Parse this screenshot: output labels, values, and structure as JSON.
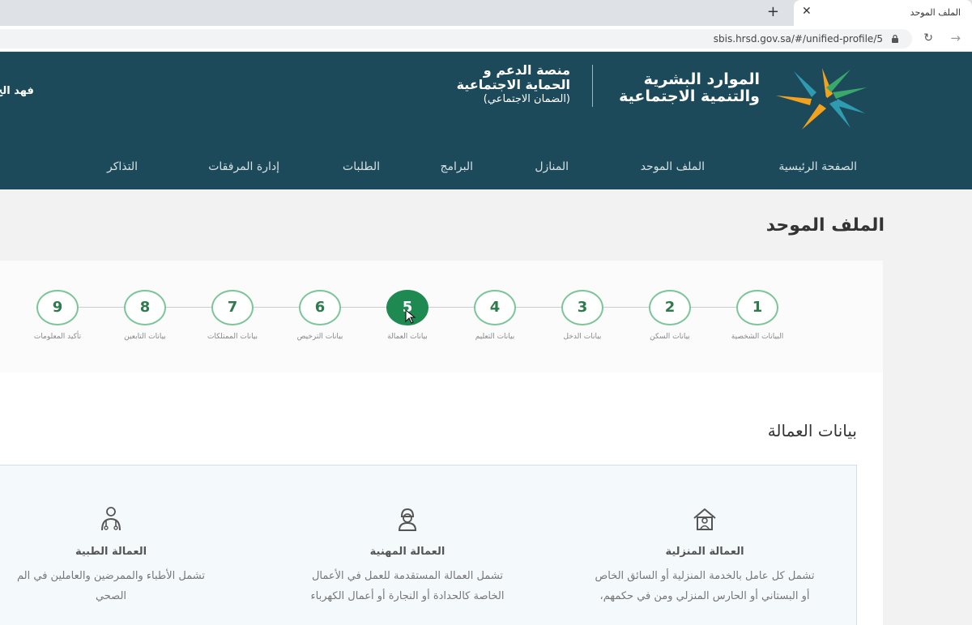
{
  "browser": {
    "tab_title": "الملف الموحد",
    "tab_close": "✕",
    "new_tab": "+",
    "url": "sbis.hrsd.gov.sa/#/unified-profile/5"
  },
  "header": {
    "ministry_line1": "الموارد البشرية",
    "ministry_line2": "والتنمية الاجتماعية",
    "platform_line1": "منصة الدعم و",
    "platform_line2": "الحماية الاجتماعية",
    "platform_line3": "(الضمان الاجتماعي)",
    "user_name": "فهد الح",
    "nav": [
      {
        "label": "الصفحة الرئيسية"
      },
      {
        "label": "الملف الموحد"
      },
      {
        "label": "المنازل"
      },
      {
        "label": "البرامج"
      },
      {
        "label": "الطلبات"
      },
      {
        "label": "إدارة المرفقات"
      },
      {
        "label": "التذاكر"
      }
    ],
    "colors": {
      "header_bg": "#1d4a5a",
      "accent_green": "#1e8a52"
    }
  },
  "page": {
    "title": "الملف الموحد",
    "section_title": "بيانات العمالة"
  },
  "stepper": {
    "active_step": 5,
    "steps": [
      {
        "num": "1",
        "label": "البيانات الشخصية"
      },
      {
        "num": "2",
        "label": "بيانات السكن"
      },
      {
        "num": "3",
        "label": "بيانات الدخل"
      },
      {
        "num": "4",
        "label": "بيانات التعليم"
      },
      {
        "num": "5",
        "label": "بيانات العمالة"
      },
      {
        "num": "6",
        "label": "بيانات الترخيص"
      },
      {
        "num": "7",
        "label": "بيانات الممتلكات"
      },
      {
        "num": "8",
        "label": "بيانات التابعين"
      },
      {
        "num": "9",
        "label": "تأكيد المعلومات"
      }
    ]
  },
  "cards": [
    {
      "icon": "house-worker-icon",
      "title": "العمالة المنزلية",
      "desc1": "تشمل كل عامل بالخدمة المنزلية أو السائق الخاص",
      "desc2": "أو البستاني أو الحارس المنزلي ومن في حكمهم،"
    },
    {
      "icon": "hardhat-worker-icon",
      "title": "العمالة المهنية",
      "desc1": "تشمل العمالة المستقدمة للعمل في الأعمال",
      "desc2": "الخاصة كالحدادة أو النجارة أو أعمال الكهرباء"
    },
    {
      "icon": "medical-staff-icon",
      "title": "العمالة الطبية",
      "desc1": "تشمل الأطباء والممرضين والعاملين في الم",
      "desc2": "الصحي"
    }
  ]
}
